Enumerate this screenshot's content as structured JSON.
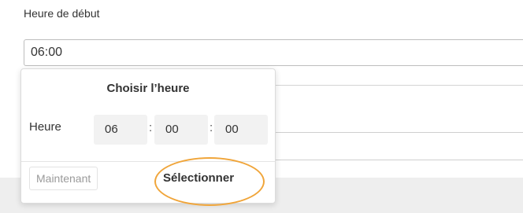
{
  "form": {
    "start_time_label": "Heure de début",
    "start_time_value": "06:00"
  },
  "picker": {
    "title": "Choisir l’heure",
    "hour_label": "Heure",
    "hours": "06",
    "minutes": "00",
    "seconds": "00",
    "separator": ":",
    "now_label": "Maintenant",
    "select_label": "Sélectionner"
  },
  "colors": {
    "highlight": "#f0a53a",
    "footer_bg": "#eeeeee"
  }
}
